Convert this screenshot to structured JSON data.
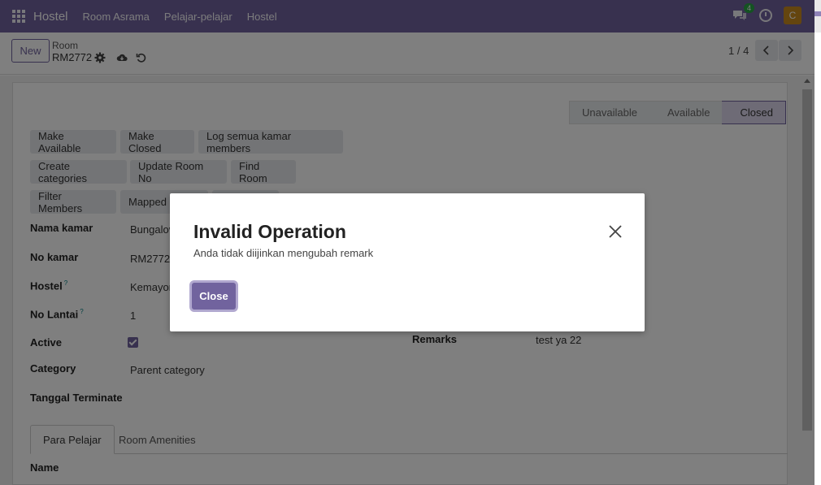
{
  "navbar": {
    "brand": "Hostel",
    "menu": [
      "Room Asrama",
      "Pelajar-pelajar",
      "Hostel"
    ],
    "chat_count": "4",
    "avatar_letter": "C"
  },
  "control": {
    "new_label": "New",
    "breadcrumb_parent": "Room",
    "breadcrumb_current": "RM2772",
    "pager": "1 / 4"
  },
  "statusbar": {
    "stages": [
      "Unavailable",
      "Available",
      "Closed"
    ],
    "active": "Closed"
  },
  "actions": {
    "make_available": "Make Available",
    "make_closed": "Make Closed",
    "log_members": "Log semua kamar members",
    "create_categories": "Create categories",
    "update_room_no": "Update Room No",
    "find_room": "Find Room",
    "filter_members": "Filter Members",
    "mapped": "Mapped"
  },
  "form": {
    "nama_kamar_label": "Nama kamar",
    "nama_kamar_value": "Bungalov",
    "no_kamar_label": "No kamar",
    "no_kamar_value": "RM2772",
    "hostel_label": "Hostel",
    "hostel_value": "Kemayor",
    "no_lantai_label": "No Lantai",
    "no_lantai_value": "1",
    "active_label": "Active",
    "category_label": "Category",
    "category_value": "Parent category",
    "tanggal_label": "Tanggal Terminate",
    "remarks_label": "Remarks",
    "remarks_value": "test ya 22",
    "help_marker": "?"
  },
  "tabs": [
    "Para Pelajar",
    "Room Amenities"
  ],
  "list": {
    "name_header": "Name"
  },
  "dialog": {
    "title": "Invalid Operation",
    "message": "Anda tidak diijinkan mengubah remark",
    "close_label": "Close"
  }
}
